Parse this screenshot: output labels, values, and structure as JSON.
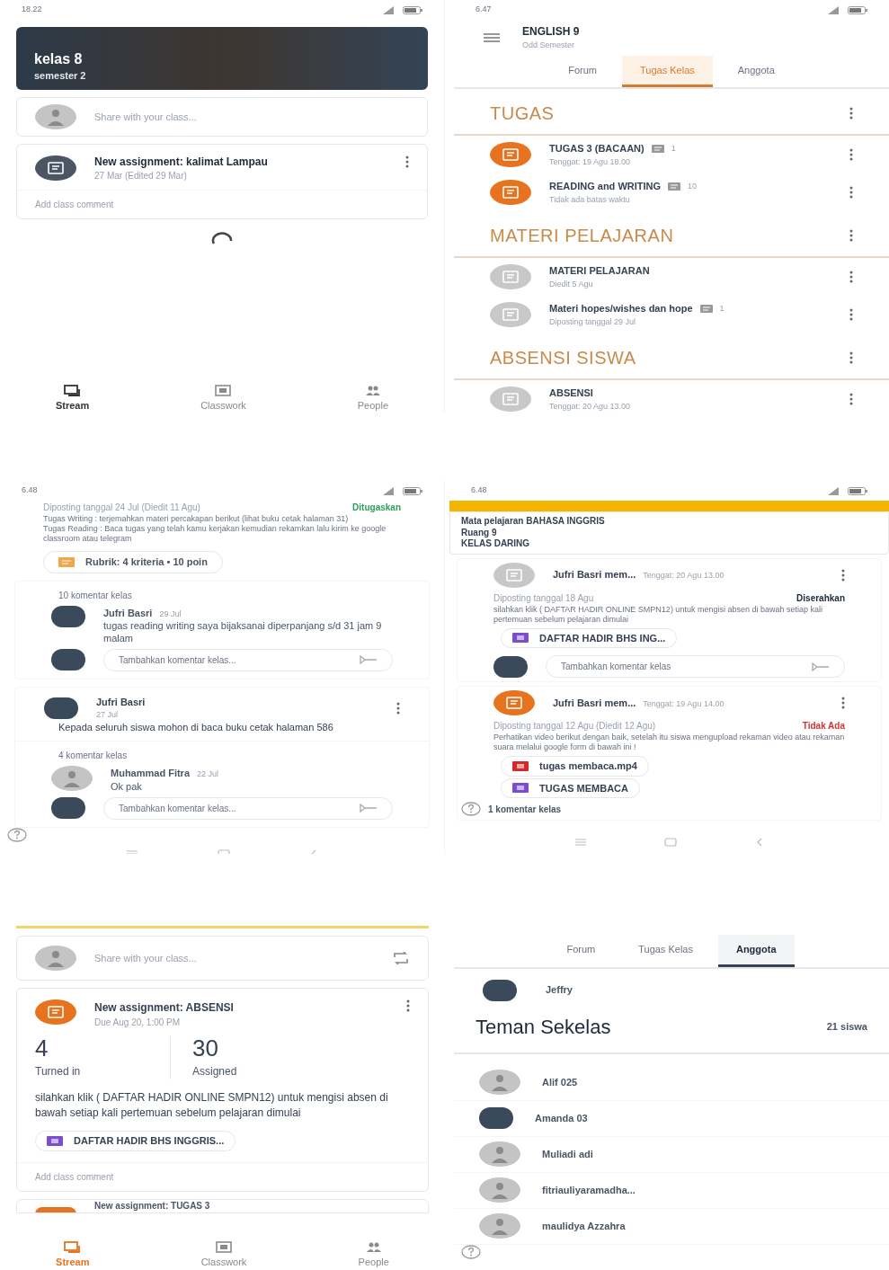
{
  "panels": [
    {
      "kind": "stream",
      "status_time": "18.22",
      "banner": {
        "title": "kelas 8",
        "subtitle": "semester 2"
      },
      "share_placeholder": "Share with your class...",
      "posts": [
        {
          "title": "New assignment: kalimat Lampau",
          "date": "27 Mar (Edited 29 Mar)",
          "comment_prompt": "Add class comment"
        }
      ],
      "nav": [
        {
          "label": "Stream",
          "selected": true
        },
        {
          "label": "Classwork",
          "selected": false
        },
        {
          "label": "People",
          "selected": false
        }
      ]
    },
    {
      "kind": "classwork",
      "status_time": "6.47",
      "course": {
        "title": "ENGLISH 9",
        "subtitle": "Odd Semester"
      },
      "tabs": [
        {
          "label": "Forum",
          "selected": false
        },
        {
          "label": "Tugas Kelas",
          "selected": true
        },
        {
          "label": "Anggota",
          "selected": false
        }
      ],
      "sections": [
        {
          "title": "TUGAS",
          "items": [
            {
              "kind": "assignment",
              "title": "TUGAS 3 (BACAAN)",
              "comments": "1",
              "subtitle": "Tenggat: 19 Agu 18.00"
            },
            {
              "kind": "assignment",
              "title": "READING and WRITING",
              "comments": "10",
              "subtitle": "Tidak ada batas waktu"
            }
          ]
        },
        {
          "title": "MATERI PELAJARAN",
          "items": [
            {
              "kind": "material",
              "title": "MATERI PELAJARAN",
              "subtitle": "Diedit 5 Agu"
            },
            {
              "kind": "material",
              "title": "Materi hopes/wishes dan hope",
              "comments": "1",
              "subtitle": "Diposting tanggal 29 Jul"
            }
          ]
        },
        {
          "title": "ABSENSI SISWA",
          "items": [
            {
              "kind": "material",
              "title": "ABSENSI",
              "subtitle": "Tenggat: 20 Agu 13.00"
            }
          ]
        }
      ]
    },
    {
      "kind": "assignment_detail",
      "status_time": "6.48",
      "posted": "Diposting tanggal 24 Jul (Diedit 11 Agu)",
      "status": {
        "kind": "assigned",
        "label": "Ditugaskan"
      },
      "description": [
        "Tugas Writing : terjemahkan materi percakapan berikut (lihat buku cetak halaman 31)",
        "Tugas Reading : Baca tugas yang telah kamu kerjakan kemudian rekamkan lalu kirim ke google classroom atau telegram"
      ],
      "rubric": "Rubrik: 4 kriteria • 10 poin",
      "threads": [
        {
          "count": "10 komentar kelas",
          "comments": [
            {
              "author": "Jufri Basri",
              "date": "29 Jul",
              "text": "tugas reading writing saya bijaksanai diperpanjang s/d 31 jam 9 malam"
            }
          ],
          "input_placeholder": "Tambahkan komentar kelas..."
        },
        {
          "author": {
            "name": "Jufri Basri",
            "date": "27 Jul",
            "text": "Kepada seluruh siswa mohon di baca buku cetak halaman 586"
          },
          "count": "4 komentar kelas",
          "comments": [
            {
              "author": "Muhammad Fitra",
              "date": "22 Jul",
              "text": "Ok pak",
              "kind": "default"
            }
          ],
          "input_placeholder": "Tambahkan komentar kelas..."
        }
      ]
    },
    {
      "kind": "class_stream",
      "status_time": "6.48",
      "info": [
        "Mata pelajaran BAHASA INGGRIS",
        "Ruang 9",
        "KELAS DARING"
      ],
      "posts": [
        {
          "kind": "material",
          "title": "Jufri Basri mem...",
          "due": "Tenggat: 20 Agu 13.00",
          "posted": "Diposting tanggal 18 Agu",
          "status": {
            "kind": "submitted",
            "label": "Diserahkan"
          },
          "body": "silahkan klik ( DAFTAR HADIR ONLINE SMPN12) untuk mengisi absen di bawah setiap kali pertemuan sebelum pelajaran dimulai",
          "attachments": [
            {
              "kind": "form",
              "label": "DAFTAR HADIR BHS ING..."
            }
          ],
          "input_placeholder": "Tambahkan komentar kelas"
        },
        {
          "kind": "assignment",
          "title": "Jufri Basri mem...",
          "due": "Tenggat: 19 Agu 14.00",
          "posted": "Diposting tanggal 12 Agu (Diedit 12 Agu)",
          "status": {
            "kind": "missing",
            "label": "Tidak Ada"
          },
          "body": "Perhatikan video berikut dengan baik, setelah itu siswa mengupload rekaman video atau rekaman suara melalui google form di bawah ini !",
          "attachments": [
            {
              "kind": "video",
              "label": "tugas membaca.mp4"
            },
            {
              "kind": "form",
              "label": "TUGAS MEMBACA"
            }
          ],
          "comment_count": "1 komentar kelas"
        }
      ]
    },
    {
      "kind": "stream_stats",
      "share_placeholder": "Share with your class...",
      "post": {
        "title": "New assignment: ABSENSI",
        "due": "Due Aug 20, 1:00 PM",
        "stats": [
          {
            "value": "4",
            "label": "Turned in"
          },
          {
            "value": "30",
            "label": "Assigned"
          }
        ],
        "body": "silahkan klik ( DAFTAR HADIR ONLINE SMPN12) untuk mengisi absen di bawah setiap kali pertemuan sebelum pelajaran dimulai",
        "attachment": "DAFTAR HADIR BHS INGGRIS...",
        "comment_prompt": "Add class comment"
      },
      "next_post": "New assignment: TUGAS 3",
      "nav": [
        {
          "label": "Stream",
          "selected": true
        },
        {
          "label": "Classwork",
          "selected": false
        },
        {
          "label": "People",
          "selected": false
        }
      ]
    },
    {
      "kind": "members",
      "tabs": [
        {
          "label": "Forum",
          "selected": false
        },
        {
          "label": "Tugas Kelas",
          "selected": false
        },
        {
          "label": "Anggota",
          "selected": true
        }
      ],
      "teacher": "Jeffry",
      "heading": "Teman Sekelas",
      "count": "21 siswa",
      "members": [
        {
          "name": "Alif 025",
          "kind": "default"
        },
        {
          "name": "Amanda 03",
          "kind": "photo"
        },
        {
          "name": "Muliadi adi",
          "kind": "default"
        },
        {
          "name": "fitriauliyaramadha...",
          "kind": "default"
        },
        {
          "name": "maulidya Azzahra",
          "kind": "default"
        }
      ]
    }
  ]
}
